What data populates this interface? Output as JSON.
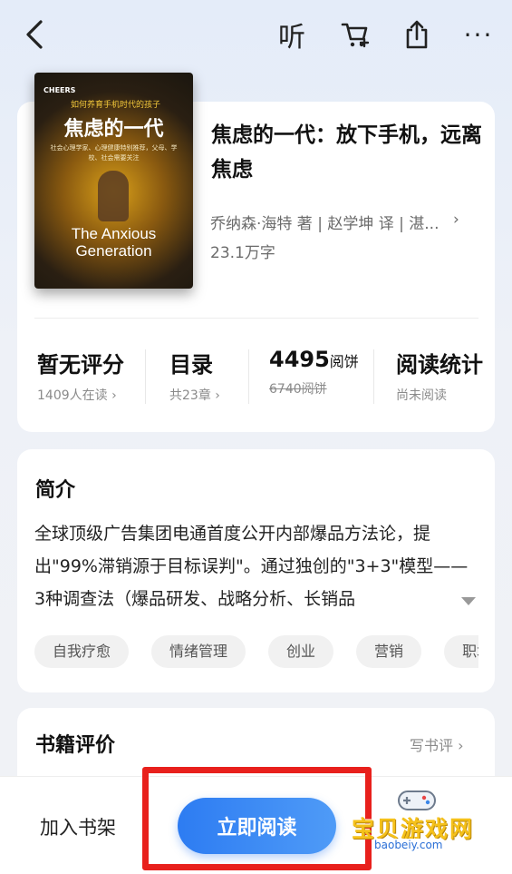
{
  "topbar": {
    "listen_label": "听",
    "more_label": "···"
  },
  "book": {
    "cover_brand": "CHEERS",
    "cover_tagline": "如何养育手机时代的孩子",
    "cover_title": "焦虑的一代",
    "cover_subtitle": "社会心理学家、心理健康特别推荐，父母、学校、社会需要关注",
    "cover_english": "The Anxious Generation",
    "title": "焦虑的一代：放下手机，远离焦虑",
    "author_line": "乔纳森·海特 著 | 赵学坤 译 | 湛...",
    "word_count": "23.1万字"
  },
  "stats": [
    {
      "main": "暂无评分",
      "sub": "1409人在读 ›"
    },
    {
      "main": "目录",
      "sub": "共23章 ›"
    },
    {
      "main": "4495",
      "unit": "阅饼",
      "sub": "6740阅饼"
    },
    {
      "main": "阅读统计",
      "sub": "尚未阅读"
    }
  ],
  "intro": {
    "title": "简介",
    "text": "全球顶级广告集团电通首度公开内部爆品方法论，提出\"99%滞销源于目标误判\"。通过独创的\"3+3\"模型——3种调查法（爆品研发、战略分析、长销品",
    "tags": [
      "自我疗愈",
      "情绪管理",
      "创业",
      "营销",
      "职场"
    ]
  },
  "review": {
    "title": "书籍评价",
    "write_label": "写书评 ›"
  },
  "bottom": {
    "add_shelf_label": "加入书架",
    "read_now_label": "立即阅读"
  },
  "watermark": {
    "icon": "game-controller-icon",
    "text": "宝贝游戏网",
    "url": "baobeiy.com"
  },
  "colors": {
    "accent": "#2d7cf2",
    "highlight": "#e8201c",
    "watermark": "#f5c11a"
  }
}
